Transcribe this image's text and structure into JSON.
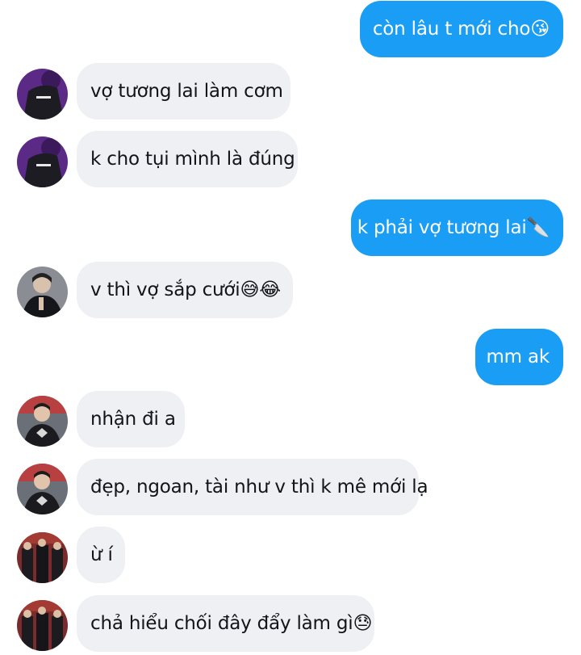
{
  "messages": [
    {
      "side": "out",
      "text": "còn lâu t mới cho😘"
    },
    {
      "side": "in",
      "avatar": "avatar-purple-jacket",
      "text": "vợ tương lai làm cơm"
    },
    {
      "side": "in",
      "avatar": "avatar-purple-jacket",
      "text": "k cho tụi mình là đúng"
    },
    {
      "side": "out",
      "text": "k phải vợ tương lai🔪"
    },
    {
      "side": "in",
      "avatar": "avatar-dark-portrait",
      "text": "v thì vợ sắp cưới😅😂"
    },
    {
      "side": "out",
      "text": "mm ak"
    },
    {
      "side": "in",
      "avatar": "avatar-red-jersey",
      "text": "nhận đi a"
    },
    {
      "side": "in",
      "avatar": "avatar-red-jersey",
      "text": "đẹp, ngoan, tài như v thì k mê mới lạ"
    },
    {
      "side": "in",
      "avatar": "avatar-team-group",
      "text": "ừ í"
    },
    {
      "side": "in",
      "avatar": "avatar-team-group",
      "text": "chả hiểu chối đây đẩy làm gì😓"
    }
  ],
  "colors": {
    "outgoing_bubble": "#1a9df5",
    "incoming_bubble": "#eef0f3",
    "outgoing_text": "#ffffff",
    "incoming_text": "#111418"
  }
}
